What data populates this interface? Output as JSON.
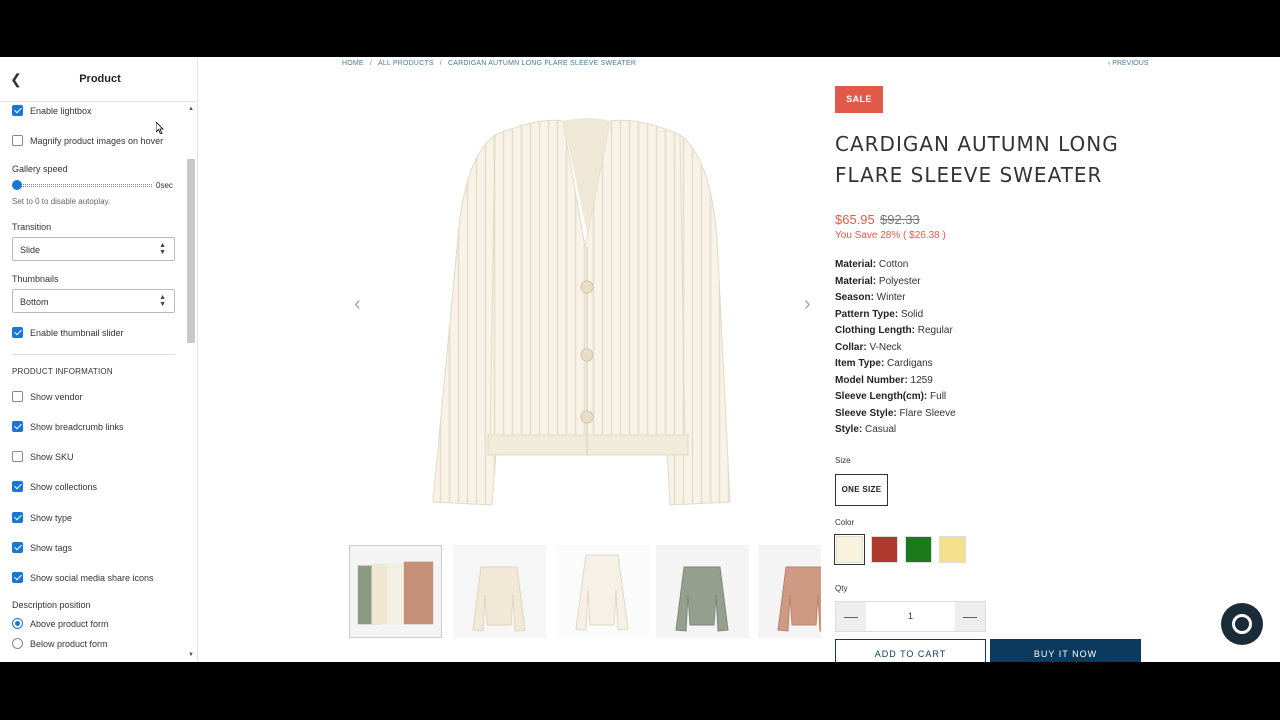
{
  "sidebar": {
    "title": "Product",
    "options": {
      "enable_lightbox": {
        "label": "Enable lightbox",
        "checked": true
      },
      "magnify": {
        "label": "Magnify product images on hover",
        "checked": false
      },
      "gallery_speed": {
        "label": "Gallery speed",
        "value": "0sec",
        "help": "Set to 0 to disable autoplay."
      },
      "transition": {
        "label": "Transition",
        "value": "Slide"
      },
      "thumbnails": {
        "label": "Thumbnails",
        "value": "Bottom"
      },
      "thumbnail_slider": {
        "label": "Enable thumbnail slider",
        "checked": true
      }
    },
    "product_info": {
      "heading": "PRODUCT INFORMATION",
      "items": [
        {
          "label": "Show vendor",
          "checked": false
        },
        {
          "label": "Show breadcrumb links",
          "checked": true
        },
        {
          "label": "Show SKU",
          "checked": false
        },
        {
          "label": "Show collections",
          "checked": true
        },
        {
          "label": "Show type",
          "checked": true
        },
        {
          "label": "Show tags",
          "checked": true
        },
        {
          "label": "Show social media share icons",
          "checked": true
        }
      ],
      "description_position": {
        "label": "Description position",
        "options": [
          {
            "label": "Above product form",
            "selected": true
          },
          {
            "label": "Below product form",
            "selected": false
          }
        ]
      }
    }
  },
  "breadcrumb": {
    "home": "HOME",
    "sep": "/",
    "all": "ALL PRODUCTS",
    "current": "CARDIGAN AUTUMN LONG FLARE SLEEVE SWEATER"
  },
  "nav": {
    "previous": "‹ PREVIOUS"
  },
  "product": {
    "badge": "SALE",
    "title": "CARDIGAN AUTUMN LONG FLARE SLEEVE SWEATER",
    "price": "$65.95",
    "compare_price": "$92.33",
    "savings": "You Save 28% ( $26.38 )",
    "attributes": [
      {
        "name": "Material:",
        "value": " Cotton"
      },
      {
        "name": "Material:",
        "value": " Polyester"
      },
      {
        "name": "Season:",
        "value": " Winter"
      },
      {
        "name": "Pattern Type:",
        "value": " Solid"
      },
      {
        "name": "Clothing Length:",
        "value": " Regular"
      },
      {
        "name": "Collar:",
        "value": " V-Neck"
      },
      {
        "name": "Item Type:",
        "value": " Cardigans"
      },
      {
        "name": "Model Number:",
        "value": " 1259"
      },
      {
        "name": "Sleeve Length(cm):",
        "value": " Full"
      },
      {
        "name": "Sleeve Style:",
        "value": " Flare Sleeve"
      },
      {
        "name": "Style:",
        "value": " Casual"
      }
    ],
    "size_label": "Size",
    "size_value": "ONE SIZE",
    "color_label": "Color",
    "colors": [
      "#f8f4dc",
      "#b03a2e",
      "#1b7a1b",
      "#f3e08c"
    ],
    "qty_label": "Qty",
    "qty_value": "1",
    "qty_minus": "—",
    "qty_plus": "—",
    "add_to_cart": "ADD TO CART",
    "buy_now": "BUY IT NOW"
  },
  "icons": {
    "back": "chevron-left-icon",
    "prev_arrow": "‹",
    "next_arrow": "›",
    "up": "▲",
    "down": "▼",
    "select_arrows": "▲\n▼"
  }
}
